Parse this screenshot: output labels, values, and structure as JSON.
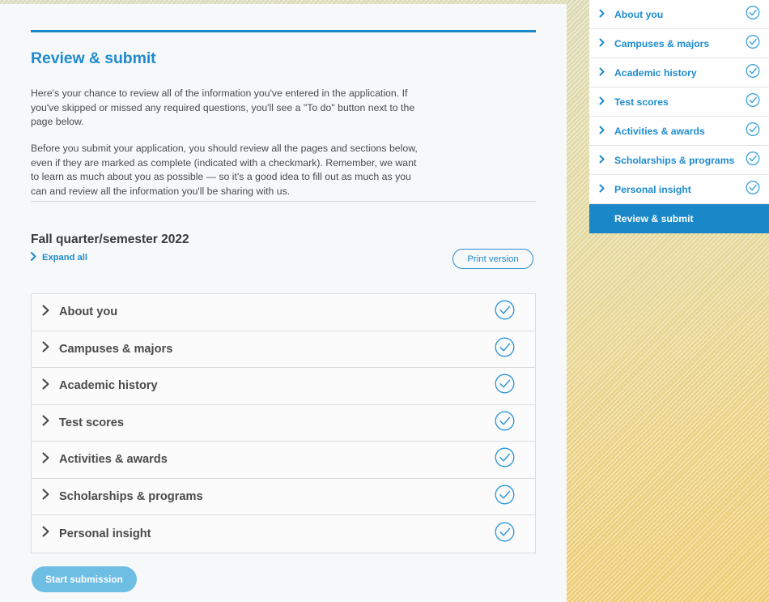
{
  "theme": {
    "accent_blue": "#1e8bcd",
    "active_blue": "#1a87c8",
    "button_blue": "#6ebee4",
    "panel_bg": "#f7f8fa",
    "row_bg": "#fbfbfc",
    "border": "#dcdcdc",
    "text_dark": "#4a4a4a",
    "bg_gradient_from": "#d9dcc0",
    "bg_gradient_to": "#efcd74"
  },
  "header": {
    "title": "Review & submit"
  },
  "intro": {
    "paragraph_1": "Here's your chance to review all of the information you've entered in the application. If you've skipped or missed any required questions, you'll see a \"To do\" button next to the page below.",
    "paragraph_2": "Before you submit your application, you should review all the pages and sections below, even if they are marked as complete (indicated with a checkmark). Remember, we want to learn as much about you as possible — so it's a good idea to fill out as much as you can and review all the information you'll be sharing with us."
  },
  "term": {
    "title": "Fall quarter/semester 2022"
  },
  "toolbar": {
    "expand_all_label": "Expand all",
    "expand_all_icon": "chevron-right-icon",
    "print_version_label": "Print version"
  },
  "accordion": {
    "rows": [
      {
        "label": "About you",
        "status": "complete",
        "chevron": "chevron-right-icon",
        "status_icon": "check-circle-icon"
      },
      {
        "label": "Campuses & majors",
        "status": "complete",
        "chevron": "chevron-right-icon",
        "status_icon": "check-circle-icon"
      },
      {
        "label": "Academic history",
        "status": "complete",
        "chevron": "chevron-right-icon",
        "status_icon": "check-circle-icon"
      },
      {
        "label": "Test scores",
        "status": "complete",
        "chevron": "chevron-right-icon",
        "status_icon": "check-circle-icon"
      },
      {
        "label": "Activities & awards",
        "status": "complete",
        "chevron": "chevron-right-icon",
        "status_icon": "check-circle-icon"
      },
      {
        "label": "Scholarships & programs",
        "status": "complete",
        "chevron": "chevron-right-icon",
        "status_icon": "check-circle-icon"
      },
      {
        "label": "Personal insight",
        "status": "complete",
        "chevron": "chevron-right-icon",
        "status_icon": "check-circle-icon"
      }
    ]
  },
  "actions": {
    "start_submission_label": "Start submission"
  },
  "sidebar": {
    "items": [
      {
        "label": "About you",
        "active": false,
        "status": "complete",
        "chevron": "chevron-right-icon",
        "status_icon": "check-circle-icon"
      },
      {
        "label": "Campuses & majors",
        "active": false,
        "status": "complete",
        "chevron": "chevron-right-icon",
        "status_icon": "check-circle-icon"
      },
      {
        "label": "Academic history",
        "active": false,
        "status": "complete",
        "chevron": "chevron-right-icon",
        "status_icon": "check-circle-icon"
      },
      {
        "label": "Test scores",
        "active": false,
        "status": "complete",
        "chevron": "chevron-right-icon",
        "status_icon": "check-circle-icon"
      },
      {
        "label": "Activities & awards",
        "active": false,
        "status": "complete",
        "chevron": "chevron-right-icon",
        "status_icon": "check-circle-icon"
      },
      {
        "label": "Scholarships & programs",
        "active": false,
        "status": "complete",
        "chevron": "chevron-right-icon",
        "status_icon": "check-circle-icon"
      },
      {
        "label": "Personal insight",
        "active": false,
        "status": "complete",
        "chevron": "chevron-right-icon",
        "status_icon": "check-circle-icon"
      },
      {
        "label": "Review & submit",
        "active": true,
        "status": "current",
        "chevron": null,
        "status_icon": null
      }
    ]
  }
}
